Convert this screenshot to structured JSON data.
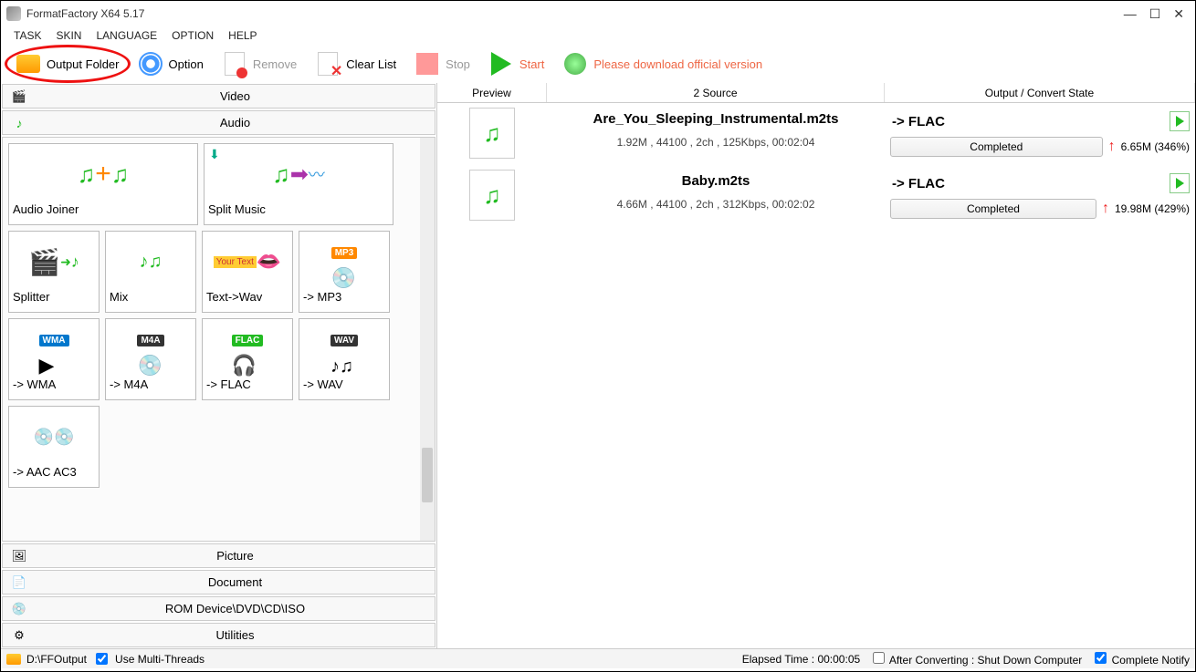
{
  "title": "FormatFactory X64 5.17",
  "menu": [
    "TASK",
    "SKIN",
    "LANGUAGE",
    "OPTION",
    "HELP"
  ],
  "toolbar": {
    "output_folder": "Output Folder",
    "option": "Option",
    "remove": "Remove",
    "clear_list": "Clear List",
    "stop": "Stop",
    "start": "Start",
    "download": "Please download official version"
  },
  "categories": {
    "video": "Video",
    "audio": "Audio",
    "picture": "Picture",
    "document": "Document",
    "rom": "ROM Device\\DVD\\CD\\ISO",
    "utilities": "Utilities"
  },
  "audio_tiles": {
    "joiner": "Audio Joiner",
    "split": "Split Music",
    "splitter": "Splitter",
    "mix": "Mix",
    "textwav": "Text->Wav",
    "mp3": "-> MP3",
    "wma": "-> WMA",
    "m4a": "-> M4A",
    "flac": "-> FLAC",
    "wav": "-> WAV",
    "aac": "-> AAC AC3"
  },
  "list_headers": {
    "preview": "Preview",
    "source": "2 Source",
    "output": "Output / Convert State"
  },
  "files": [
    {
      "name": "Are_You_Sleeping_Instrumental.m2ts",
      "info": "1.92M , 44100 , 2ch , 125Kbps, 00:02:04",
      "target": "->  FLAC",
      "status": "Completed",
      "size": "6.65M",
      "pct": "(346%)"
    },
    {
      "name": "Baby.m2ts",
      "info": "4.66M , 44100 , 2ch , 312Kbps, 00:02:02",
      "target": "->  FLAC",
      "status": "Completed",
      "size": "19.98M",
      "pct": "(429%)"
    }
  ],
  "statusbar": {
    "output_path": "D:\\FFOutput",
    "multithreads": "Use Multi-Threads",
    "elapsed": "Elapsed Time : 00:00:05",
    "after": "After Converting : Shut Down Computer",
    "notify": "Complete Notify"
  }
}
